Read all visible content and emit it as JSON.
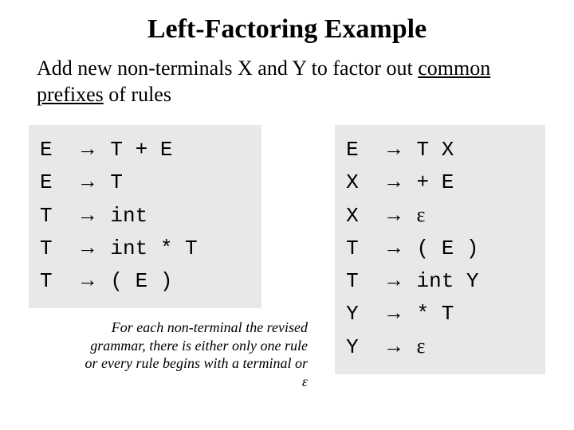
{
  "title": "Left-Factoring Example",
  "subtitle": {
    "part1": "Add new non-terminals X and Y to factor out ",
    "underlined": "common prefixes",
    "part2": " of rules"
  },
  "left_rules": [
    {
      "lhs": "E",
      "rhs": "T + E"
    },
    {
      "lhs": "E",
      "rhs": "T"
    },
    {
      "lhs": "T",
      "rhs": "int"
    },
    {
      "lhs": "T",
      "rhs": "int * T"
    },
    {
      "lhs": "T",
      "rhs": "( E )"
    }
  ],
  "right_rules": [
    {
      "lhs": "E",
      "rhs": "T X"
    },
    {
      "lhs": "X",
      "rhs": "+ E"
    },
    {
      "lhs": "X",
      "rhs": "ε"
    },
    {
      "lhs": "T",
      "rhs": "( E )"
    },
    {
      "lhs": "T",
      "rhs": "int Y"
    },
    {
      "lhs": "Y",
      "rhs": "* T"
    },
    {
      "lhs": "Y",
      "rhs": "ε"
    }
  ],
  "note": "For each non-terminal the revised grammar, there is either only one rule or every rule begins with a terminal or ε"
}
